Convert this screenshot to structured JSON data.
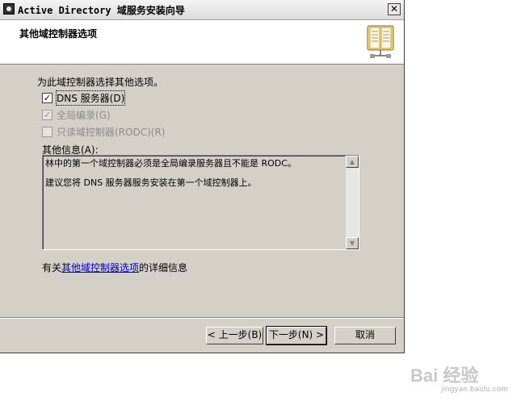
{
  "window": {
    "title": "Active Directory 域服务安装向导",
    "close_glyph": "✕"
  },
  "header": {
    "title": "其他域控制器选项",
    "icon": "book-icon"
  },
  "main": {
    "prompt": "为此域控制器选择其他选项。",
    "options": [
      {
        "label": "DNS 服务器(D)",
        "checked": true,
        "enabled": true
      },
      {
        "label": "全局编录(G)",
        "checked": true,
        "enabled": false
      },
      {
        "label": "只读域控制器(RODC)(R)",
        "checked": false,
        "enabled": false
      }
    ],
    "info_label": "其他信息(A):",
    "info_lines": [
      "林中的第一个域控制器必须是全局编录服务器且不能是 RODC。",
      "建议您将 DNS 服务器服务安装在第一个域控制器上。"
    ],
    "more_prefix": "有关",
    "more_link": "其他域控制器选项",
    "more_suffix": "的详细信息"
  },
  "buttons": {
    "back": "< 上一步(B)",
    "next": "下一步(N) >",
    "cancel": "取消"
  },
  "watermark": {
    "brand": "Bai 经验",
    "url": "jingyan.baidu.com"
  }
}
